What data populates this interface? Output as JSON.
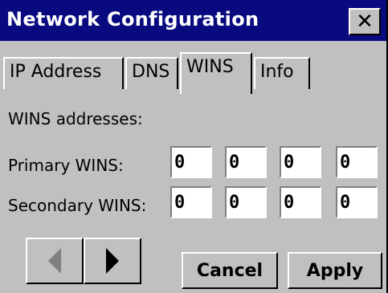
{
  "window": {
    "title": "Network Configuration",
    "close_symbol": "✕"
  },
  "tabs": [
    {
      "label": "IP Address",
      "active": false
    },
    {
      "label": "DNS",
      "active": false
    },
    {
      "label": "WINS",
      "active": true
    },
    {
      "label": "Info",
      "active": false
    }
  ],
  "wins": {
    "heading": "WINS addresses:",
    "primary_label": "Primary WINS:",
    "secondary_label": "Secondary WINS:",
    "primary_octets": [
      "0",
      "0",
      "0",
      "0"
    ],
    "secondary_octets": [
      "0",
      "0",
      "0",
      "0"
    ]
  },
  "buttons": {
    "prev_icon": "left-arrow-icon",
    "next_icon": "right-arrow-icon",
    "cancel": "Cancel",
    "apply": "Apply"
  },
  "colors": {
    "titlebar": "#0a0a80",
    "face": "#c0c0c0",
    "disabled_arrow": "#808080"
  }
}
